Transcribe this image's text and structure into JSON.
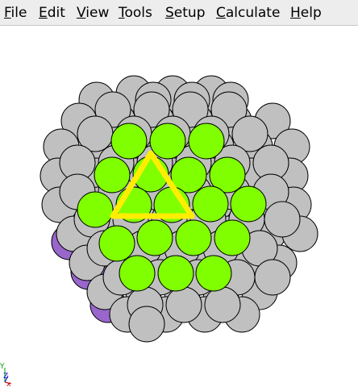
{
  "menu": {
    "file": {
      "mnemonic": "F",
      "rest": "ile"
    },
    "edit": {
      "mnemonic": "E",
      "rest": "dit"
    },
    "view": {
      "mnemonic": "V",
      "rest": "iew"
    },
    "tools": {
      "mnemonic": "T",
      "rest": "ools"
    },
    "setup": {
      "mnemonic": "S",
      "rest": "etup"
    },
    "calculate": {
      "mnemonic": "C",
      "rest": "alculate"
    },
    "help": {
      "mnemonic": "H",
      "rest": "elp"
    }
  },
  "axes": {
    "x": "x",
    "y": "Y",
    "z": "Z"
  },
  "colors": {
    "menubar_bg": "#ededed",
    "gray_atom": "#c0c0c0",
    "green_atom": "#80ff00",
    "purple_atom": "#9966cc",
    "triangle": "#ffee00",
    "axis_x": "#cc0000",
    "axis_y": "#009900",
    "axis_z": "#0000cc",
    "outline": "#000000"
  },
  "scene": {
    "atom_types": [
      "gray-atom",
      "green-atom",
      "purple-atom"
    ],
    "selection_shape": "triangle"
  }
}
